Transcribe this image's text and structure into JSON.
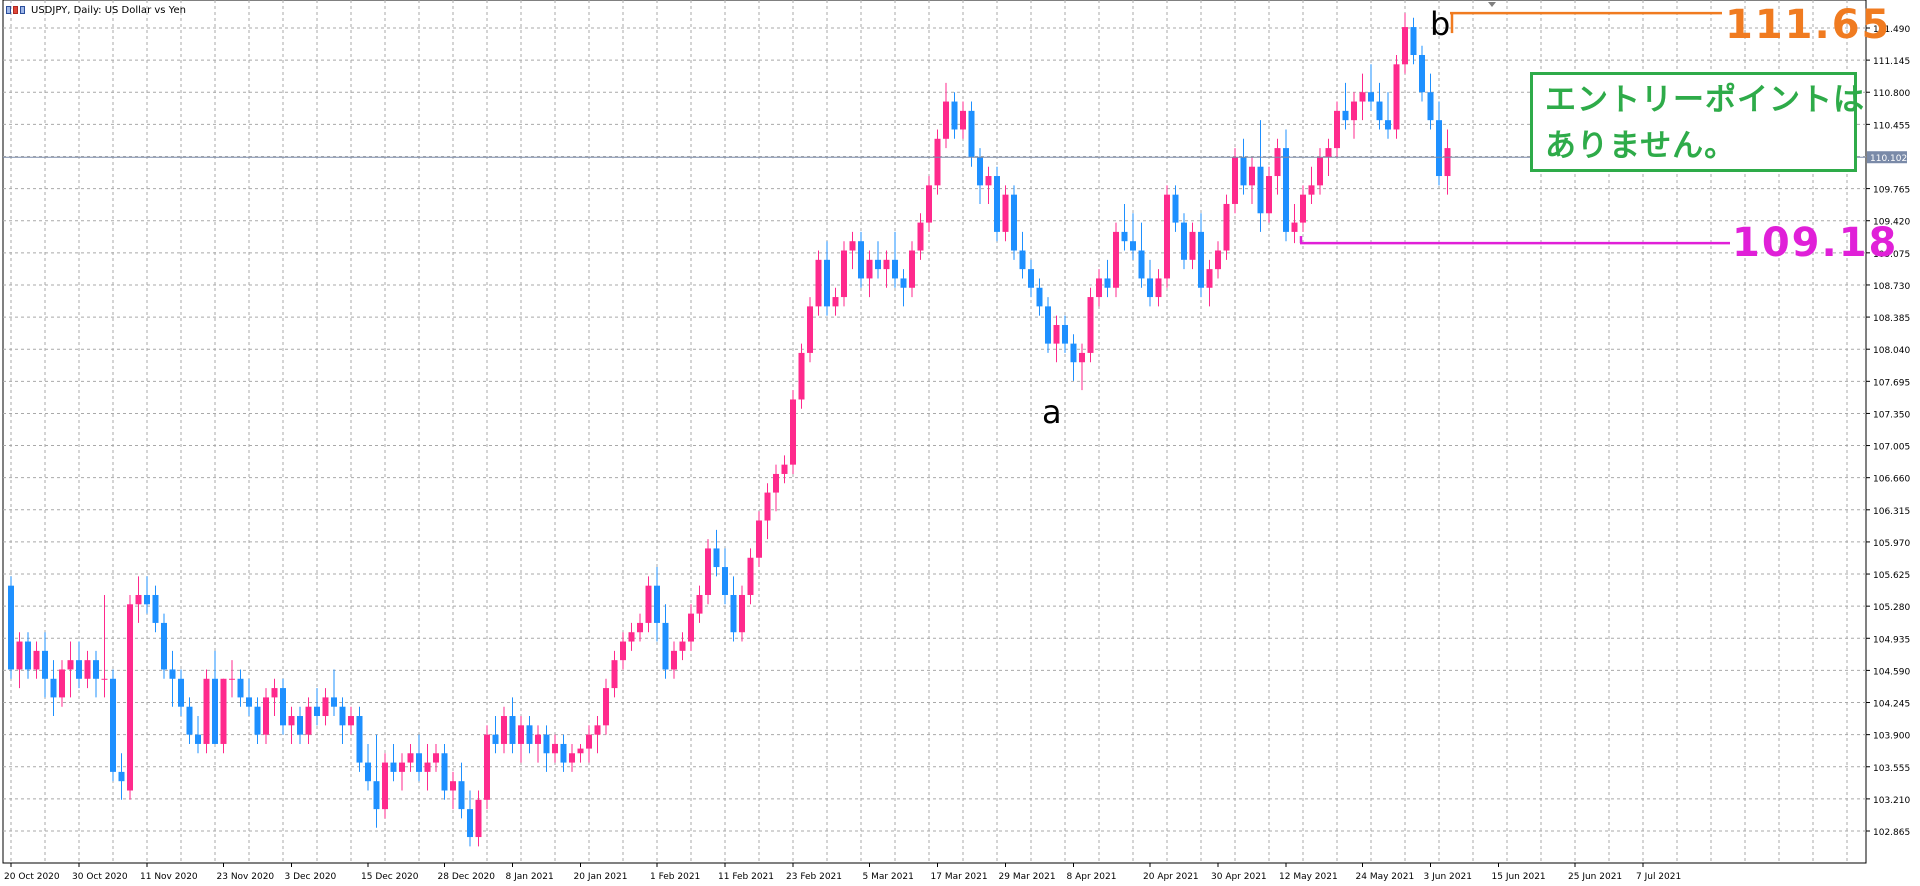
{
  "window": {
    "title": "USDJPY, Daily:  US Dollar vs Yen"
  },
  "annotations": {
    "entry_box_lines": [
      "エントリーポイントは",
      "ありません。"
    ],
    "high_label": "111.65",
    "low_label": "109.18",
    "swing_a": "a",
    "swing_b": "b"
  },
  "colors": {
    "bull": "#ff2a8c",
    "bear": "#1e90ff",
    "high_line": "#f07b20",
    "low_line": "#e020d8",
    "entry_box": "#2eab49",
    "grid": "#a9a9a9"
  },
  "chart_data": {
    "type": "candlestick",
    "symbol": "USDJPY",
    "timeframe": "Daily",
    "ylim": [
      102.65,
      111.72
    ],
    "y_ticks": [
      "111.490",
      "111.145",
      "110.800",
      "110.455",
      "110.102",
      "109.765",
      "109.420",
      "109.075",
      "108.730",
      "108.385",
      "108.040",
      "107.695",
      "107.350",
      "107.005",
      "106.660",
      "106.315",
      "105.970",
      "105.625",
      "105.280",
      "104.935",
      "104.590",
      "104.245",
      "103.900",
      "103.555",
      "103.210",
      "102.865"
    ],
    "current_price": "110.102",
    "x_ticks": [
      {
        "label": "20 Oct 2020",
        "index": 0
      },
      {
        "label": "30 Oct 2020",
        "index": 8
      },
      {
        "label": "11 Nov 2020",
        "index": 16
      },
      {
        "label": "23 Nov 2020",
        "index": 25
      },
      {
        "label": "3 Dec 2020",
        "index": 33
      },
      {
        "label": "15 Dec 2020",
        "index": 42
      },
      {
        "label": "28 Dec 2020",
        "index": 51
      },
      {
        "label": "8 Jan 2021",
        "index": 59
      },
      {
        "label": "20 Jan 2021",
        "index": 67
      },
      {
        "label": "1 Feb 2021",
        "index": 76
      },
      {
        "label": "11 Feb 2021",
        "index": 84
      },
      {
        "label": "23 Feb 2021",
        "index": 92
      },
      {
        "label": "5 Mar 2021",
        "index": 101
      },
      {
        "label": "17 Mar 2021",
        "index": 109
      },
      {
        "label": "29 Mar 2021",
        "index": 117
      },
      {
        "label": "8 Apr 2021",
        "index": 125
      },
      {
        "label": "20 Apr 2021",
        "index": 134
      },
      {
        "label": "30 Apr 2021",
        "index": 142
      },
      {
        "label": "12 May 2021",
        "index": 150
      },
      {
        "label": "24 May 2021",
        "index": 159
      },
      {
        "label": "3 Jun 2021",
        "index": 167
      },
      {
        "label": "15 Jun 2021",
        "index": 175
      },
      {
        "label": "25 Jun 2021",
        "index": 184
      },
      {
        "label": "7 Jul 2021",
        "index": 192
      }
    ],
    "candles": [
      [
        105.5,
        105.6,
        104.5,
        104.6
      ],
      [
        104.6,
        105.0,
        104.4,
        104.9
      ],
      [
        104.9,
        105.0,
        104.5,
        104.6
      ],
      [
        104.6,
        104.9,
        104.5,
        104.8
      ],
      [
        104.8,
        105.0,
        104.3,
        104.5
      ],
      [
        104.5,
        104.7,
        104.1,
        104.3
      ],
      [
        104.3,
        104.7,
        104.2,
        104.6
      ],
      [
        104.6,
        104.9,
        104.3,
        104.7
      ],
      [
        104.7,
        104.9,
        104.4,
        104.5
      ],
      [
        104.5,
        104.8,
        104.4,
        104.7
      ],
      [
        104.7,
        104.8,
        104.3,
        104.5
      ],
      [
        104.5,
        105.4,
        104.3,
        104.5
      ],
      [
        104.5,
        104.6,
        103.4,
        103.5
      ],
      [
        103.5,
        103.7,
        103.2,
        103.4
      ],
      [
        103.3,
        105.4,
        103.2,
        105.3
      ],
      [
        105.3,
        105.6,
        105.1,
        105.4
      ],
      [
        105.4,
        105.6,
        105.2,
        105.3
      ],
      [
        105.4,
        105.5,
        105.0,
        105.1
      ],
      [
        105.1,
        105.2,
        104.5,
        104.6
      ],
      [
        104.6,
        104.8,
        104.2,
        104.5
      ],
      [
        104.5,
        104.6,
        104.1,
        104.2
      ],
      [
        104.2,
        104.3,
        103.8,
        103.9
      ],
      [
        103.9,
        104.1,
        103.7,
        103.8
      ],
      [
        103.8,
        104.6,
        103.7,
        104.5
      ],
      [
        104.5,
        104.8,
        103.8,
        103.8
      ],
      [
        103.8,
        104.5,
        103.7,
        104.5
      ],
      [
        104.5,
        104.7,
        104.3,
        104.5
      ],
      [
        104.5,
        104.6,
        104.2,
        104.3
      ],
      [
        104.3,
        104.5,
        104.1,
        104.2
      ],
      [
        104.2,
        104.3,
        103.8,
        103.9
      ],
      [
        103.9,
        104.4,
        103.8,
        104.3
      ],
      [
        104.3,
        104.5,
        104.1,
        104.4
      ],
      [
        104.4,
        104.5,
        103.9,
        104.0
      ],
      [
        104.0,
        104.2,
        103.8,
        104.1
      ],
      [
        104.1,
        104.2,
        103.8,
        103.9
      ],
      [
        103.9,
        104.3,
        103.8,
        104.2
      ],
      [
        104.2,
        104.4,
        104.0,
        104.1
      ],
      [
        104.1,
        104.4,
        104.0,
        104.3
      ],
      [
        104.3,
        104.6,
        104.1,
        104.2
      ],
      [
        104.2,
        104.3,
        103.8,
        104.0
      ],
      [
        104.0,
        104.2,
        103.9,
        104.1
      ],
      [
        104.1,
        104.2,
        103.5,
        103.6
      ],
      [
        103.6,
        103.8,
        103.3,
        103.4
      ],
      [
        103.4,
        103.9,
        102.9,
        103.1
      ],
      [
        103.1,
        103.7,
        103.0,
        103.6
      ],
      [
        103.6,
        103.8,
        103.4,
        103.5
      ],
      [
        103.5,
        103.7,
        103.3,
        103.6
      ],
      [
        103.6,
        103.8,
        103.5,
        103.7
      ],
      [
        103.7,
        103.9,
        103.4,
        103.5
      ],
      [
        103.5,
        103.8,
        103.3,
        103.6
      ],
      [
        103.6,
        103.8,
        103.5,
        103.7
      ],
      [
        103.7,
        103.8,
        103.2,
        103.3
      ],
      [
        103.3,
        103.5,
        103.1,
        103.4
      ],
      [
        103.4,
        103.6,
        103.0,
        103.1
      ],
      [
        103.1,
        103.3,
        102.7,
        102.8
      ],
      [
        102.8,
        103.3,
        102.7,
        103.2
      ],
      [
        103.2,
        104.0,
        103.1,
        103.9
      ],
      [
        103.9,
        104.1,
        103.7,
        103.8
      ],
      [
        103.8,
        104.2,
        103.7,
        104.1
      ],
      [
        104.1,
        104.3,
        103.7,
        103.8
      ],
      [
        103.8,
        104.1,
        103.6,
        104.0
      ],
      [
        104.0,
        104.1,
        103.7,
        103.8
      ],
      [
        103.8,
        104.0,
        103.6,
        103.9
      ],
      [
        103.9,
        104.0,
        103.5,
        103.7
      ],
      [
        103.7,
        103.9,
        103.6,
        103.8
      ],
      [
        103.8,
        103.9,
        103.5,
        103.6
      ],
      [
        103.6,
        103.8,
        103.5,
        103.7
      ],
      [
        103.7,
        103.8,
        103.6,
        103.75
      ],
      [
        103.75,
        104.0,
        103.6,
        103.9
      ],
      [
        103.9,
        104.1,
        103.7,
        104.0
      ],
      [
        104.0,
        104.5,
        103.9,
        104.4
      ],
      [
        104.4,
        104.8,
        104.3,
        104.7
      ],
      [
        104.7,
        105.0,
        104.6,
        104.9
      ],
      [
        104.9,
        105.1,
        104.8,
        105.0
      ],
      [
        105.0,
        105.2,
        104.9,
        105.1
      ],
      [
        105.1,
        105.6,
        105.0,
        105.5
      ],
      [
        105.5,
        105.7,
        104.9,
        105.1
      ],
      [
        105.1,
        105.3,
        104.5,
        104.6
      ],
      [
        104.6,
        104.9,
        104.5,
        104.8
      ],
      [
        104.8,
        105.0,
        104.7,
        104.9
      ],
      [
        104.9,
        105.3,
        104.8,
        105.2
      ],
      [
        105.2,
        105.5,
        105.1,
        105.4
      ],
      [
        105.4,
        106.0,
        105.3,
        105.9
      ],
      [
        105.9,
        106.1,
        105.6,
        105.7
      ],
      [
        105.7,
        105.9,
        105.3,
        105.4
      ],
      [
        105.4,
        105.6,
        104.9,
        105.0
      ],
      [
        105.0,
        105.5,
        104.9,
        105.4
      ],
      [
        105.4,
        105.9,
        105.3,
        105.8
      ],
      [
        105.8,
        106.3,
        105.7,
        106.2
      ],
      [
        106.2,
        106.6,
        106.0,
        106.5
      ],
      [
        106.5,
        106.8,
        106.3,
        106.7
      ],
      [
        106.7,
        106.9,
        106.6,
        106.8
      ],
      [
        106.8,
        107.6,
        106.7,
        107.5
      ],
      [
        107.5,
        108.1,
        107.4,
        108.0
      ],
      [
        108.0,
        108.6,
        107.9,
        108.5
      ],
      [
        108.5,
        109.1,
        108.4,
        109.0
      ],
      [
        109.0,
        109.2,
        108.4,
        108.5
      ],
      [
        108.5,
        108.7,
        108.4,
        108.6
      ],
      [
        108.6,
        109.2,
        108.5,
        109.1
      ],
      [
        109.1,
        109.3,
        108.9,
        109.2
      ],
      [
        109.2,
        109.3,
        108.7,
        108.8
      ],
      [
        108.8,
        109.1,
        108.6,
        109.0
      ],
      [
        109.0,
        109.2,
        108.8,
        108.9
      ],
      [
        108.9,
        109.1,
        108.7,
        109.0
      ],
      [
        109.0,
        109.3,
        108.7,
        108.8
      ],
      [
        108.8,
        108.9,
        108.5,
        108.7
      ],
      [
        108.7,
        109.2,
        108.6,
        109.1
      ],
      [
        109.1,
        109.5,
        109.0,
        109.4
      ],
      [
        109.4,
        109.9,
        109.3,
        109.8
      ],
      [
        109.8,
        110.4,
        109.7,
        110.3
      ],
      [
        110.3,
        110.9,
        110.2,
        110.7
      ],
      [
        110.7,
        110.8,
        110.3,
        110.4
      ],
      [
        110.4,
        110.7,
        110.3,
        110.6
      ],
      [
        110.6,
        110.7,
        110.0,
        110.1
      ],
      [
        110.1,
        110.2,
        109.6,
        109.8
      ],
      [
        109.8,
        110.0,
        109.6,
        109.9
      ],
      [
        109.9,
        110.0,
        109.2,
        109.3
      ],
      [
        109.3,
        109.8,
        109.2,
        109.7
      ],
      [
        109.7,
        109.8,
        109.0,
        109.1
      ],
      [
        109.1,
        109.3,
        108.8,
        108.9
      ],
      [
        108.9,
        109.0,
        108.6,
        108.7
      ],
      [
        108.7,
        108.8,
        108.4,
        108.5
      ],
      [
        108.5,
        108.6,
        108.0,
        108.1
      ],
      [
        108.1,
        108.4,
        107.9,
        108.3
      ],
      [
        108.3,
        108.4,
        108.0,
        108.1
      ],
      [
        108.1,
        108.2,
        107.7,
        107.9
      ],
      [
        107.9,
        108.1,
        107.6,
        108.0
      ],
      [
        108.0,
        108.7,
        107.9,
        108.6
      ],
      [
        108.6,
        108.9,
        108.5,
        108.8
      ],
      [
        108.8,
        109.0,
        108.6,
        108.7
      ],
      [
        108.7,
        109.4,
        108.6,
        109.3
      ],
      [
        109.3,
        109.6,
        109.1,
        109.2
      ],
      [
        109.2,
        109.5,
        109.0,
        109.1
      ],
      [
        109.1,
        109.4,
        108.7,
        108.8
      ],
      [
        108.8,
        109.0,
        108.5,
        108.6
      ],
      [
        108.6,
        108.9,
        108.5,
        108.8
      ],
      [
        108.8,
        109.8,
        108.7,
        109.7
      ],
      [
        109.7,
        109.8,
        109.3,
        109.4
      ],
      [
        109.4,
        109.5,
        108.9,
        109.0
      ],
      [
        109.0,
        109.4,
        108.9,
        109.3
      ],
      [
        109.3,
        109.5,
        108.6,
        108.7
      ],
      [
        108.7,
        109.0,
        108.5,
        108.9
      ],
      [
        108.9,
        109.2,
        108.8,
        109.1
      ],
      [
        109.1,
        109.7,
        109.0,
        109.6
      ],
      [
        109.6,
        110.2,
        109.5,
        110.1
      ],
      [
        110.1,
        110.3,
        109.7,
        109.8
      ],
      [
        109.8,
        110.1,
        109.6,
        110.0
      ],
      [
        110.0,
        110.5,
        109.3,
        109.5
      ],
      [
        109.5,
        110.0,
        109.4,
        109.9
      ],
      [
        109.9,
        110.3,
        109.7,
        110.2
      ],
      [
        110.2,
        110.4,
        109.2,
        109.3
      ],
      [
        109.3,
        109.6,
        109.18,
        109.4
      ],
      [
        109.4,
        109.8,
        109.3,
        109.7
      ],
      [
        109.7,
        110.0,
        109.6,
        109.8
      ],
      [
        109.8,
        110.2,
        109.7,
        110.1
      ],
      [
        110.1,
        110.3,
        109.9,
        110.2
      ],
      [
        110.2,
        110.7,
        110.1,
        110.6
      ],
      [
        110.6,
        110.9,
        110.4,
        110.5
      ],
      [
        110.5,
        110.8,
        110.3,
        110.7
      ],
      [
        110.7,
        111.0,
        110.5,
        110.8
      ],
      [
        110.8,
        111.1,
        110.6,
        110.7
      ],
      [
        110.7,
        110.9,
        110.4,
        110.5
      ],
      [
        110.5,
        110.8,
        110.3,
        110.4
      ],
      [
        110.4,
        111.2,
        110.3,
        111.1
      ],
      [
        111.1,
        111.65,
        111.0,
        111.5
      ],
      [
        111.5,
        111.6,
        111.1,
        111.2
      ],
      [
        111.2,
        111.3,
        110.7,
        110.8
      ],
      [
        110.8,
        111.0,
        110.4,
        110.5
      ],
      [
        110.5,
        110.7,
        109.8,
        109.9
      ],
      [
        109.9,
        110.4,
        109.7,
        110.2
      ]
    ],
    "high_level": 111.65,
    "low_level": 109.18
  }
}
